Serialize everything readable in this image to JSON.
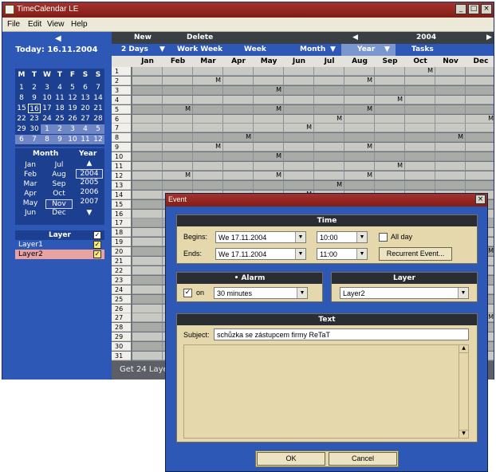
{
  "window": {
    "title": "TimeCalendar LE",
    "controls": [
      "_",
      "□",
      "×"
    ]
  },
  "menu": [
    "File",
    "Edit",
    "View",
    "Help"
  ],
  "sidebar": {
    "today": "Today: 16.11.2004",
    "minical": {
      "weekday_headers": [
        "M",
        "T",
        "W",
        "T",
        "F",
        "S",
        "S"
      ],
      "weeks": [
        [
          "1",
          "2",
          "3",
          "4",
          "5",
          "6",
          "7"
        ],
        [
          "8",
          "9",
          "10",
          "11",
          "12",
          "13",
          "14"
        ],
        [
          "15",
          "16",
          "17",
          "18",
          "19",
          "20",
          "21"
        ],
        [
          "22",
          "23",
          "24",
          "25",
          "26",
          "27",
          "28"
        ],
        [
          "29",
          "30",
          "1",
          "2",
          "3",
          "4",
          "5"
        ],
        [
          "6",
          "7",
          "8",
          "9",
          "10",
          "11",
          "12"
        ]
      ]
    },
    "picker": {
      "month_label": "Month",
      "year_label": "Year",
      "months": [
        [
          "Jan",
          "Jul"
        ],
        [
          "Feb",
          "Aug"
        ],
        [
          "Mar",
          "Sep"
        ],
        [
          "Apr",
          "Oct"
        ],
        [
          "May",
          "Nov"
        ],
        [
          "Jun",
          "Dec"
        ]
      ],
      "years": [
        "2004",
        "2005",
        "2006",
        "2007"
      ],
      "selected_month": "Nov",
      "selected_year": "2004"
    },
    "layers": {
      "label": "Layer",
      "items": [
        {
          "name": "Layer1",
          "color": "#2e58b6",
          "checked": true
        },
        {
          "name": "Layer2",
          "color": "#e8a2a2",
          "checked": true
        }
      ]
    }
  },
  "toolbar": {
    "new_label": "New",
    "delete_label": "Delete",
    "year_value": "2004",
    "views": [
      "2 Days",
      "Work Week",
      "Week",
      "Month",
      "Year",
      "Tasks"
    ],
    "active_view": "Year"
  },
  "grid": {
    "months": [
      "Jan",
      "Feb",
      "Mar",
      "Apr",
      "May",
      "Jun",
      "Jul",
      "Aug",
      "Sep",
      "Oct",
      "Nov",
      "Dec"
    ],
    "day_numbers": [
      "1",
      "2",
      "3",
      "4",
      "5",
      "6",
      "7",
      "8",
      "9",
      "10",
      "11",
      "12",
      "13",
      "14",
      "15",
      "16",
      "17",
      "18",
      "19",
      "20",
      "21",
      "22",
      "23",
      "24",
      "25",
      "26",
      "27",
      "28",
      "29",
      "30",
      "31"
    ],
    "marker": "M",
    "footer_text": "Get 24 Layer"
  },
  "dialog": {
    "title": "Event",
    "close": "×",
    "time": {
      "header": "Time",
      "begins_label": "Begins:",
      "begins_date": "We 17.11.2004",
      "begins_time": "10:00",
      "ends_label": "Ends:",
      "ends_date": "We 17.11.2004",
      "ends_time": "11:00",
      "allday_label": "All day",
      "recurrent_label": "Recurrent Event..."
    },
    "alarm": {
      "header": "• Alarm",
      "on_label": "on",
      "value": "30 minutes"
    },
    "layer": {
      "header": "Layer",
      "value": "Layer2"
    },
    "text": {
      "header": "Text",
      "subject_label": "Subject:",
      "subject_value": "schůzka se zástupcem firmy ReTaT"
    },
    "ok_label": "OK",
    "cancel_label": "Cancel"
  }
}
